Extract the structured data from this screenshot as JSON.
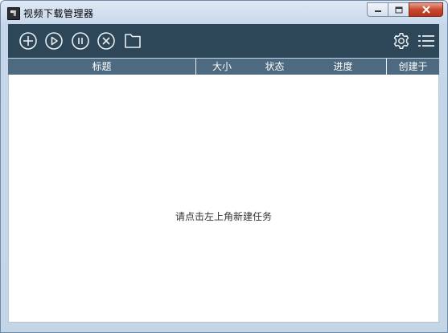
{
  "window": {
    "title": "视频下载管理器"
  },
  "toolbar": {
    "add_icon": "plus-circle",
    "play_icon": "play-circle",
    "pause_icon": "pause-circle",
    "delete_icon": "close-circle",
    "folder_icon": "folder",
    "settings_icon": "gear",
    "menu_icon": "list-menu"
  },
  "table": {
    "columns": [
      "标题",
      "大小",
      "状态",
      "进度",
      "创建于"
    ]
  },
  "content": {
    "empty_hint": "请点击左上角新建任务"
  },
  "colors": {
    "toolbar_bg": "#2e4758",
    "header_bg": "#4d6a80",
    "close_button": "#c8472f"
  }
}
